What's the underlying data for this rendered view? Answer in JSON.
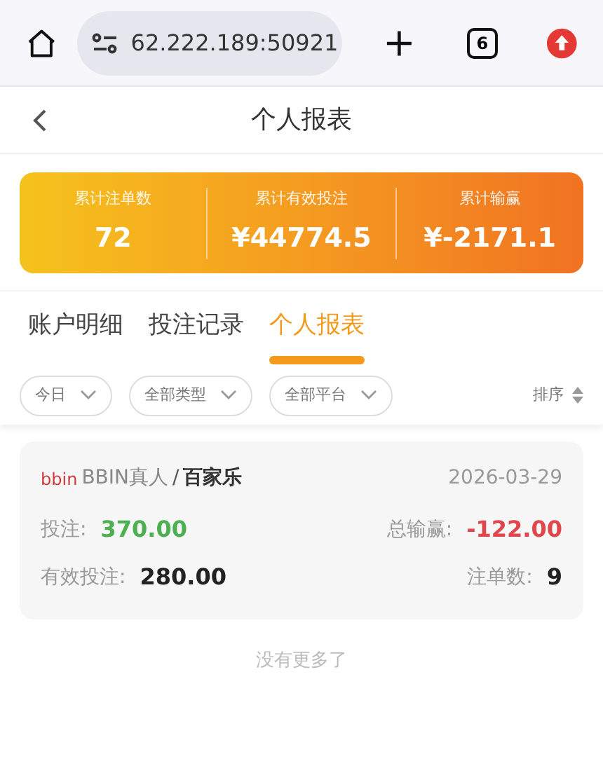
{
  "browser": {
    "url": "62.222.189:50921",
    "tab_count": "6"
  },
  "header": {
    "title": "个人报表"
  },
  "stats": [
    {
      "label": "累计注单数",
      "value": "72"
    },
    {
      "label": "累计有效投注",
      "value": "¥44774.5"
    },
    {
      "label": "累计输赢",
      "value": "¥-2171.1"
    }
  ],
  "tabs": [
    {
      "label": "账户明细",
      "selected": false
    },
    {
      "label": "投注记录",
      "selected": false
    },
    {
      "label": "个人报表",
      "selected": true
    }
  ],
  "filters": [
    {
      "label": "今日"
    },
    {
      "label": "全部类型"
    },
    {
      "label": "全部平台"
    }
  ],
  "sort": {
    "label": "排序"
  },
  "records": [
    {
      "logo": "bbin",
      "platform": "BBIN真人",
      "separator": "/",
      "game": "百家乐",
      "date": "2026-03-29",
      "fields": [
        {
          "label": "投注:",
          "value": "370.00",
          "color": "#4caf50"
        },
        {
          "label": "总输赢:",
          "value": "-122.00",
          "color": "#e0474c"
        },
        {
          "label": "有效投注:",
          "value": "280.00",
          "color": "#222222"
        },
        {
          "label": "注单数:",
          "value": "9",
          "color": "#222222"
        }
      ]
    }
  ],
  "footer": "没有更多了"
}
